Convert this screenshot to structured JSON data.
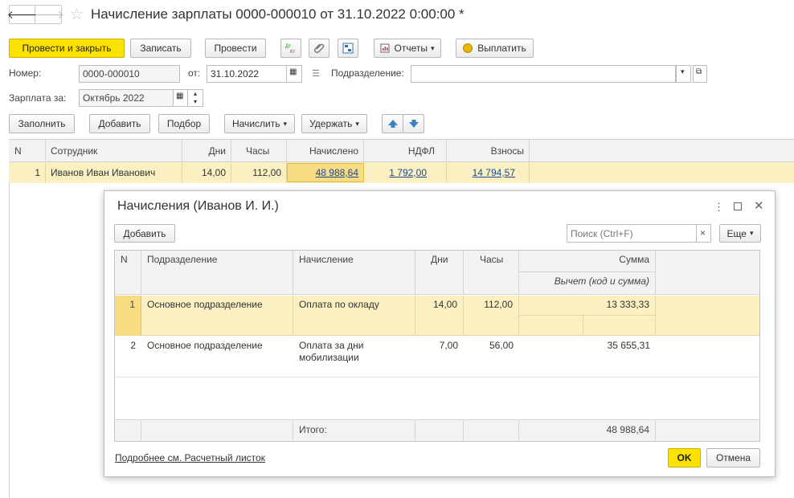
{
  "window": {
    "title": "Начисление зарплаты 0000-000010 от 31.10.2022 0:00:00 *",
    "nav_back": "🡐",
    "nav_forward": "🡒",
    "star_icon": "star-icon"
  },
  "toolbar": {
    "post_close": "Провести и закрыть",
    "save": "Записать",
    "post": "Провести",
    "dt_kt_label": "Дт Кт",
    "reports": "Отчеты",
    "pay": "Выплатить"
  },
  "form": {
    "number_label": "Номер:",
    "number_value": "0000-000010",
    "date_label": "от:",
    "date_value": "31.10.2022",
    "dept_label": "Подразделение:",
    "dept_value": "",
    "period_label": "Зарплата за:",
    "period_value": "Октябрь 2022"
  },
  "table_toolbar": {
    "fill": "Заполнить",
    "add": "Добавить",
    "select": "Подбор",
    "accrue": "Начислить",
    "withhold": "Удержать"
  },
  "main_table": {
    "headers": [
      "N",
      "Сотрудник",
      "Дни",
      "Часы",
      "Начислено",
      "НДФЛ",
      "Взносы"
    ],
    "rows": [
      {
        "n": "1",
        "employee": "Иванов Иван Иванович",
        "days": "14,00",
        "hours": "112,00",
        "accrued": "48 988,64",
        "ndfl": "1 792,00",
        "contrib": "14 794,57"
      }
    ]
  },
  "dialog": {
    "title": "Начисления (Иванов И. И.)",
    "add": "Добавить",
    "search_placeholder": "Поиск (Ctrl+F)",
    "search_clear": "×",
    "more": "Еще",
    "headers": {
      "n": "N",
      "dept": "Подразделение",
      "accrual": "Начисление",
      "days": "Дни",
      "hours": "Часы",
      "sum": "Сумма",
      "deduction": "Вычет (код и сумма)"
    },
    "rows": [
      {
        "n": "1",
        "dept": "Основное подразделение",
        "accrual": "Оплата по окладу",
        "days": "14,00",
        "hours": "112,00",
        "sum": "13 333,33"
      },
      {
        "n": "2",
        "dept": "Основное подразделение",
        "accrual": "Оплата за дни мобилизации",
        "days": "7,00",
        "hours": "56,00",
        "sum": "35 655,31"
      }
    ],
    "total_label": "Итого:",
    "total_sum": "48 988,64",
    "details_link": "Подробнее см. Расчетный листок",
    "ok": "OK",
    "cancel": "Отмена"
  },
  "colors": {
    "primary_yellow": "#fce200",
    "row_highlight": "#fbf0c2",
    "link": "#1a4b96"
  }
}
